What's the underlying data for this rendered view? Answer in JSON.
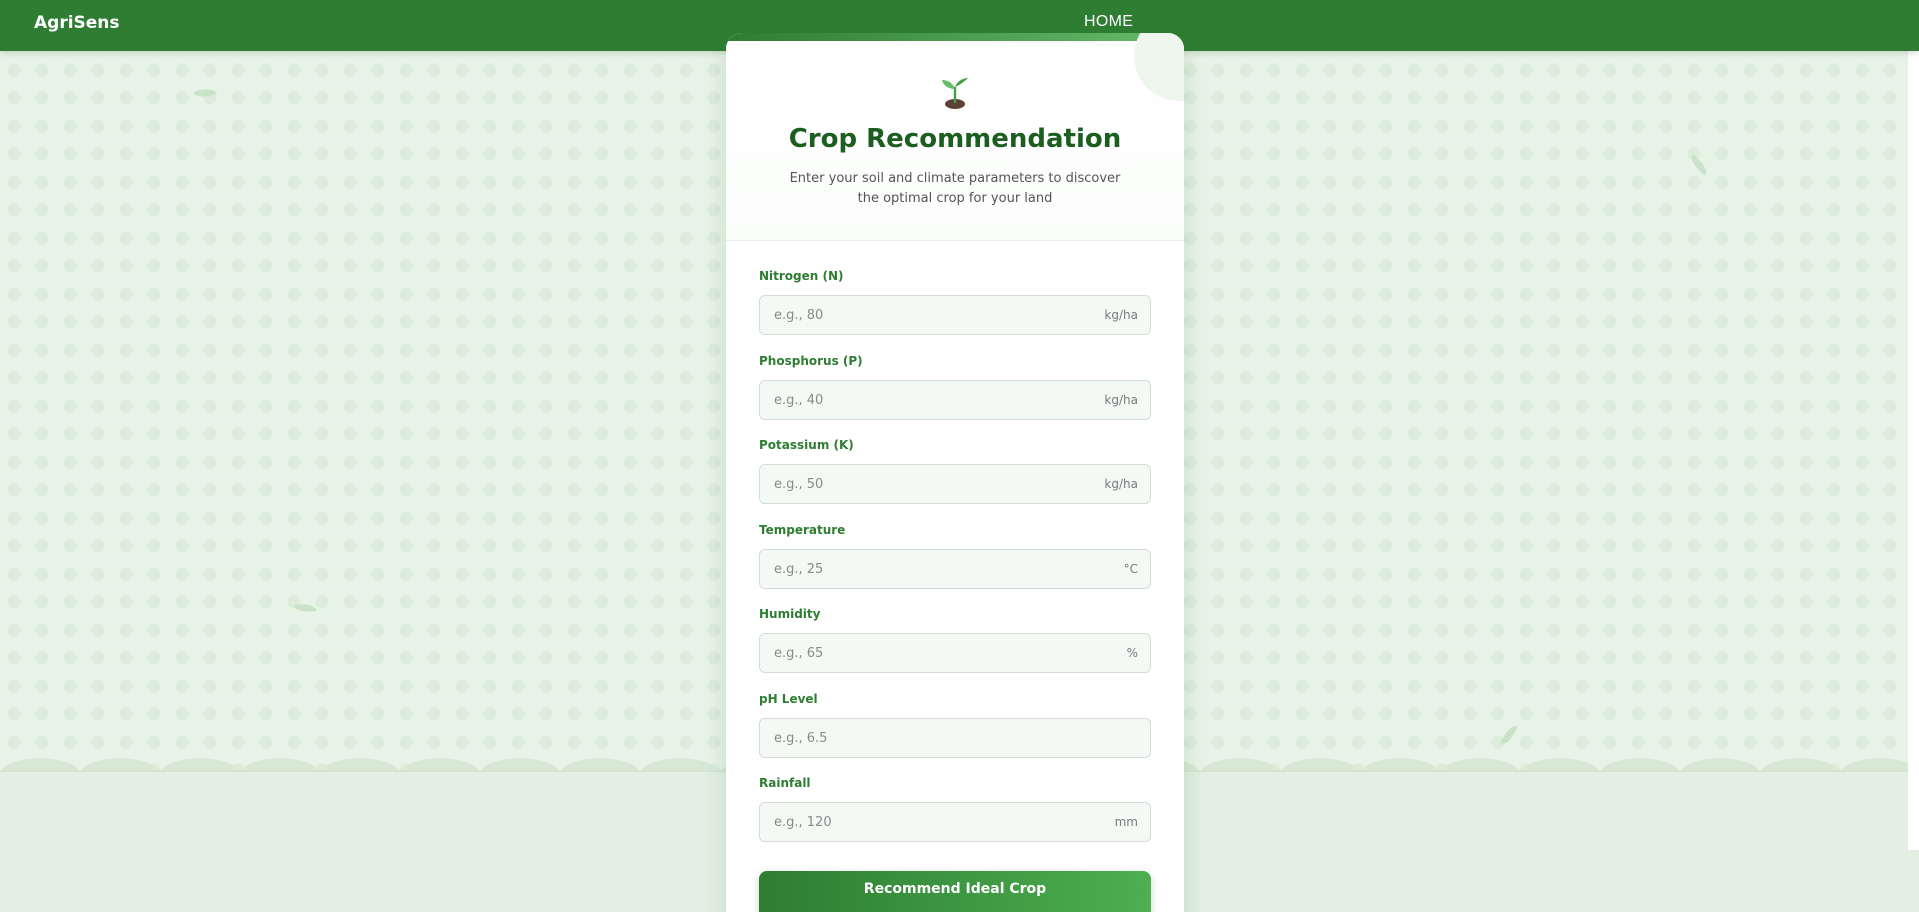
{
  "navbar": {
    "brand": "AgriSens",
    "home_link": "HOME"
  },
  "card": {
    "icon": "seedling-icon",
    "title": "Crop Recommendation",
    "subtitle": "Enter your soil and climate parameters to discover the optimal crop for your land",
    "fields": [
      {
        "label": "Nitrogen (N)",
        "placeholder": "e.g., 80",
        "unit": "kg/ha"
      },
      {
        "label": "Phosphorus (P)",
        "placeholder": "e.g., 40",
        "unit": "kg/ha"
      },
      {
        "label": "Potassium (K)",
        "placeholder": "e.g., 50",
        "unit": "kg/ha"
      },
      {
        "label": "Temperature",
        "placeholder": "e.g., 25",
        "unit": "°C"
      },
      {
        "label": "Humidity",
        "placeholder": "e.g., 65",
        "unit": "%"
      },
      {
        "label": "pH Level",
        "placeholder": "e.g., 6.5",
        "unit": ""
      },
      {
        "label": "Rainfall",
        "placeholder": "e.g., 120",
        "unit": "mm"
      }
    ],
    "submit_label": "Recommend Ideal Crop"
  },
  "colors": {
    "brand_green": "#2e7d32",
    "title_green": "#1b5e20",
    "background": "#e8f3e7"
  }
}
